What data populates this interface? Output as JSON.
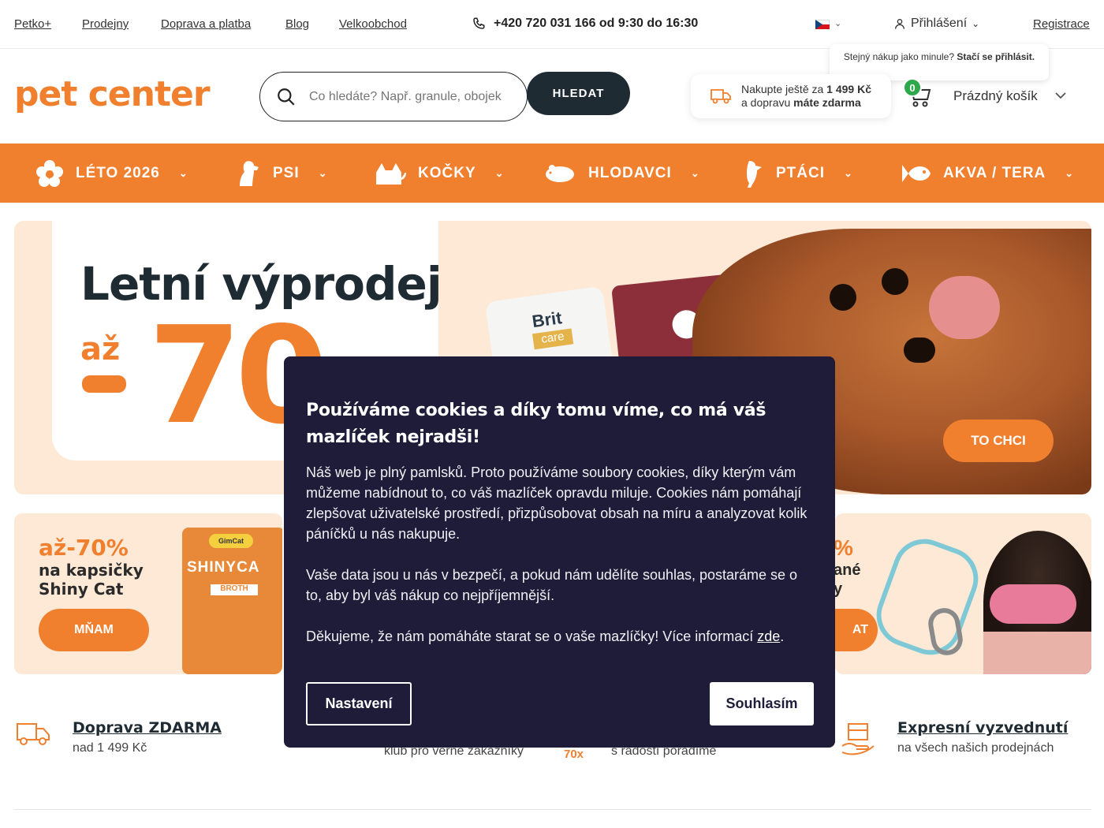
{
  "topbar": {
    "links": [
      "Petko+",
      "Prodejny",
      "Doprava a platba",
      "Blog",
      "Velkoobchod"
    ],
    "phone": "+420 720 031 166 od 9:30 do 16:30",
    "login": "Přihlášení",
    "register": "Registrace",
    "tooltip_prefix": "Stejný nákup jako minule? ",
    "tooltip_bold": "Stačí se přihlásit."
  },
  "header": {
    "logo": "pet center",
    "search_placeholder": "Co hledáte? Např. granule, obojek",
    "search_button": "HLEDAT",
    "shipping_line1_prefix": "Nakupte ještě za ",
    "shipping_amount": "1 499 Kč",
    "shipping_line2_prefix": "a dopravu ",
    "shipping_free": "máte zdarma",
    "cart_count": "0",
    "cart_label": "Prázdný košík"
  },
  "nav": {
    "items": [
      {
        "label": "LÉTO 2026",
        "icon": "flower-icon"
      },
      {
        "label": "PSI",
        "icon": "dog-icon"
      },
      {
        "label": "KOČKY",
        "icon": "cat-icon"
      },
      {
        "label": "HLODAVCI",
        "icon": "rodent-icon"
      },
      {
        "label": "PTÁCI",
        "icon": "bird-icon"
      },
      {
        "label": "AKVA / TERA",
        "icon": "fish-icon"
      }
    ]
  },
  "hero": {
    "title": "Letní výprodej",
    "prefix": "až",
    "discount": "70",
    "brand1": "Brit",
    "brand1_sub": "care",
    "cta": "TO CHCI"
  },
  "promos": {
    "left": {
      "pct": "až-70%",
      "line1": "na kapsičky",
      "line2": "Shiny Cat",
      "cta": "MŇAM",
      "pack_brand": "GimCat",
      "pack_name": "SHINYCA",
      "pack_tag": "BROTH"
    },
    "right": {
      "pct": "%",
      "line1": "ané",
      "line2": "y",
      "cta": "AT"
    }
  },
  "usps": {
    "shipping_title": "Doprava ZDARMA",
    "shipping_sub": "nad 1 499 Kč",
    "club_sub": "klub pro věrné zákazníky",
    "advice_badge": "70x",
    "advice_sub": "s radostí poradíme",
    "pickup_title": "Expresní vyzvednutí",
    "pickup_sub": "na všech našich prodejnách"
  },
  "cookie": {
    "title": "Používáme cookies a díky tomu víme, co má váš mazlíček nejradši!",
    "p1": "Náš web je plný pamlsků. Proto používáme soubory cookies, díky kterým vám můžeme nabídnout to, co váš mazlíček opravdu miluje. Cookies nám pomáhají zlepšovat uživatelské prostředí, přizpůsobovat obsah na míru a analyzovat kolik páníčků u nás nakupuje.",
    "p2": "Vaše data jsou u nás v bezpečí, a pokud nám udělíte souhlas, postaráme se o to, aby byl váš nákup co nejpříjemnější.",
    "p3_prefix": "Děkujeme, že nám pomáháte starat se o vaše mazlíčky! Více informací ",
    "p3_link": "zde",
    "p3_suffix": ".",
    "settings_button": "Nastavení",
    "agree_button": "Souhlasím"
  },
  "colors": {
    "brand_orange": "#f07f2e",
    "dark_navy": "#1f2b33",
    "modal_bg": "#1e1c38",
    "cart_badge": "#2da84a"
  }
}
